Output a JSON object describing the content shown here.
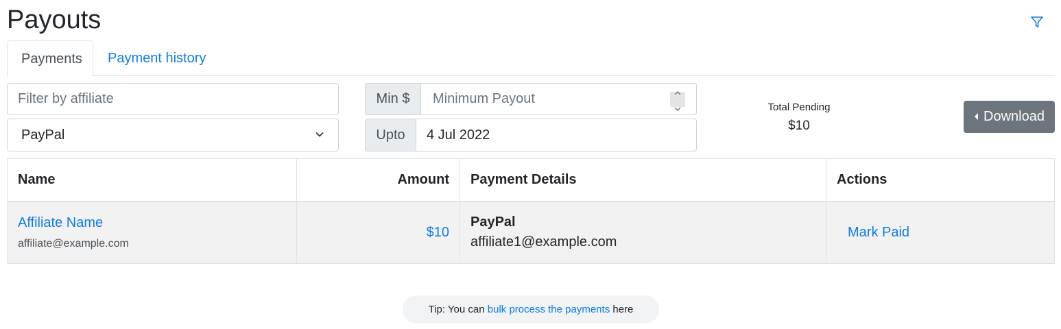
{
  "page": {
    "title": "Payouts"
  },
  "tabs": [
    {
      "label": "Payments",
      "active": true
    },
    {
      "label": "Payment history",
      "active": false
    }
  ],
  "filters": {
    "affiliate_placeholder": "Filter by affiliate",
    "method_selected": "PayPal",
    "min_addon": "Min $",
    "min_placeholder": "Minimum Payout",
    "upto_addon": "Upto",
    "upto_value": "4 Jul 2022"
  },
  "summary": {
    "pending_label": "Total Pending",
    "pending_value": "$10"
  },
  "actions": {
    "download_label": "Download"
  },
  "table": {
    "headers": [
      "Name",
      "Amount",
      "Payment Details",
      "Actions"
    ],
    "rows": [
      {
        "name": "Affiliate Name",
        "email": "affiliate@example.com",
        "amount": "$10",
        "method": "PayPal",
        "payment_email": "affiliate1@example.com",
        "action": "Mark Paid"
      }
    ]
  },
  "tip": {
    "prefix": "Tip: You can ",
    "link": "bulk process the payments",
    "suffix": " here"
  },
  "colors": {
    "link": "#0d7ce8",
    "button_secondary": "#6c757d",
    "row_bg": "#f2f2f2"
  }
}
